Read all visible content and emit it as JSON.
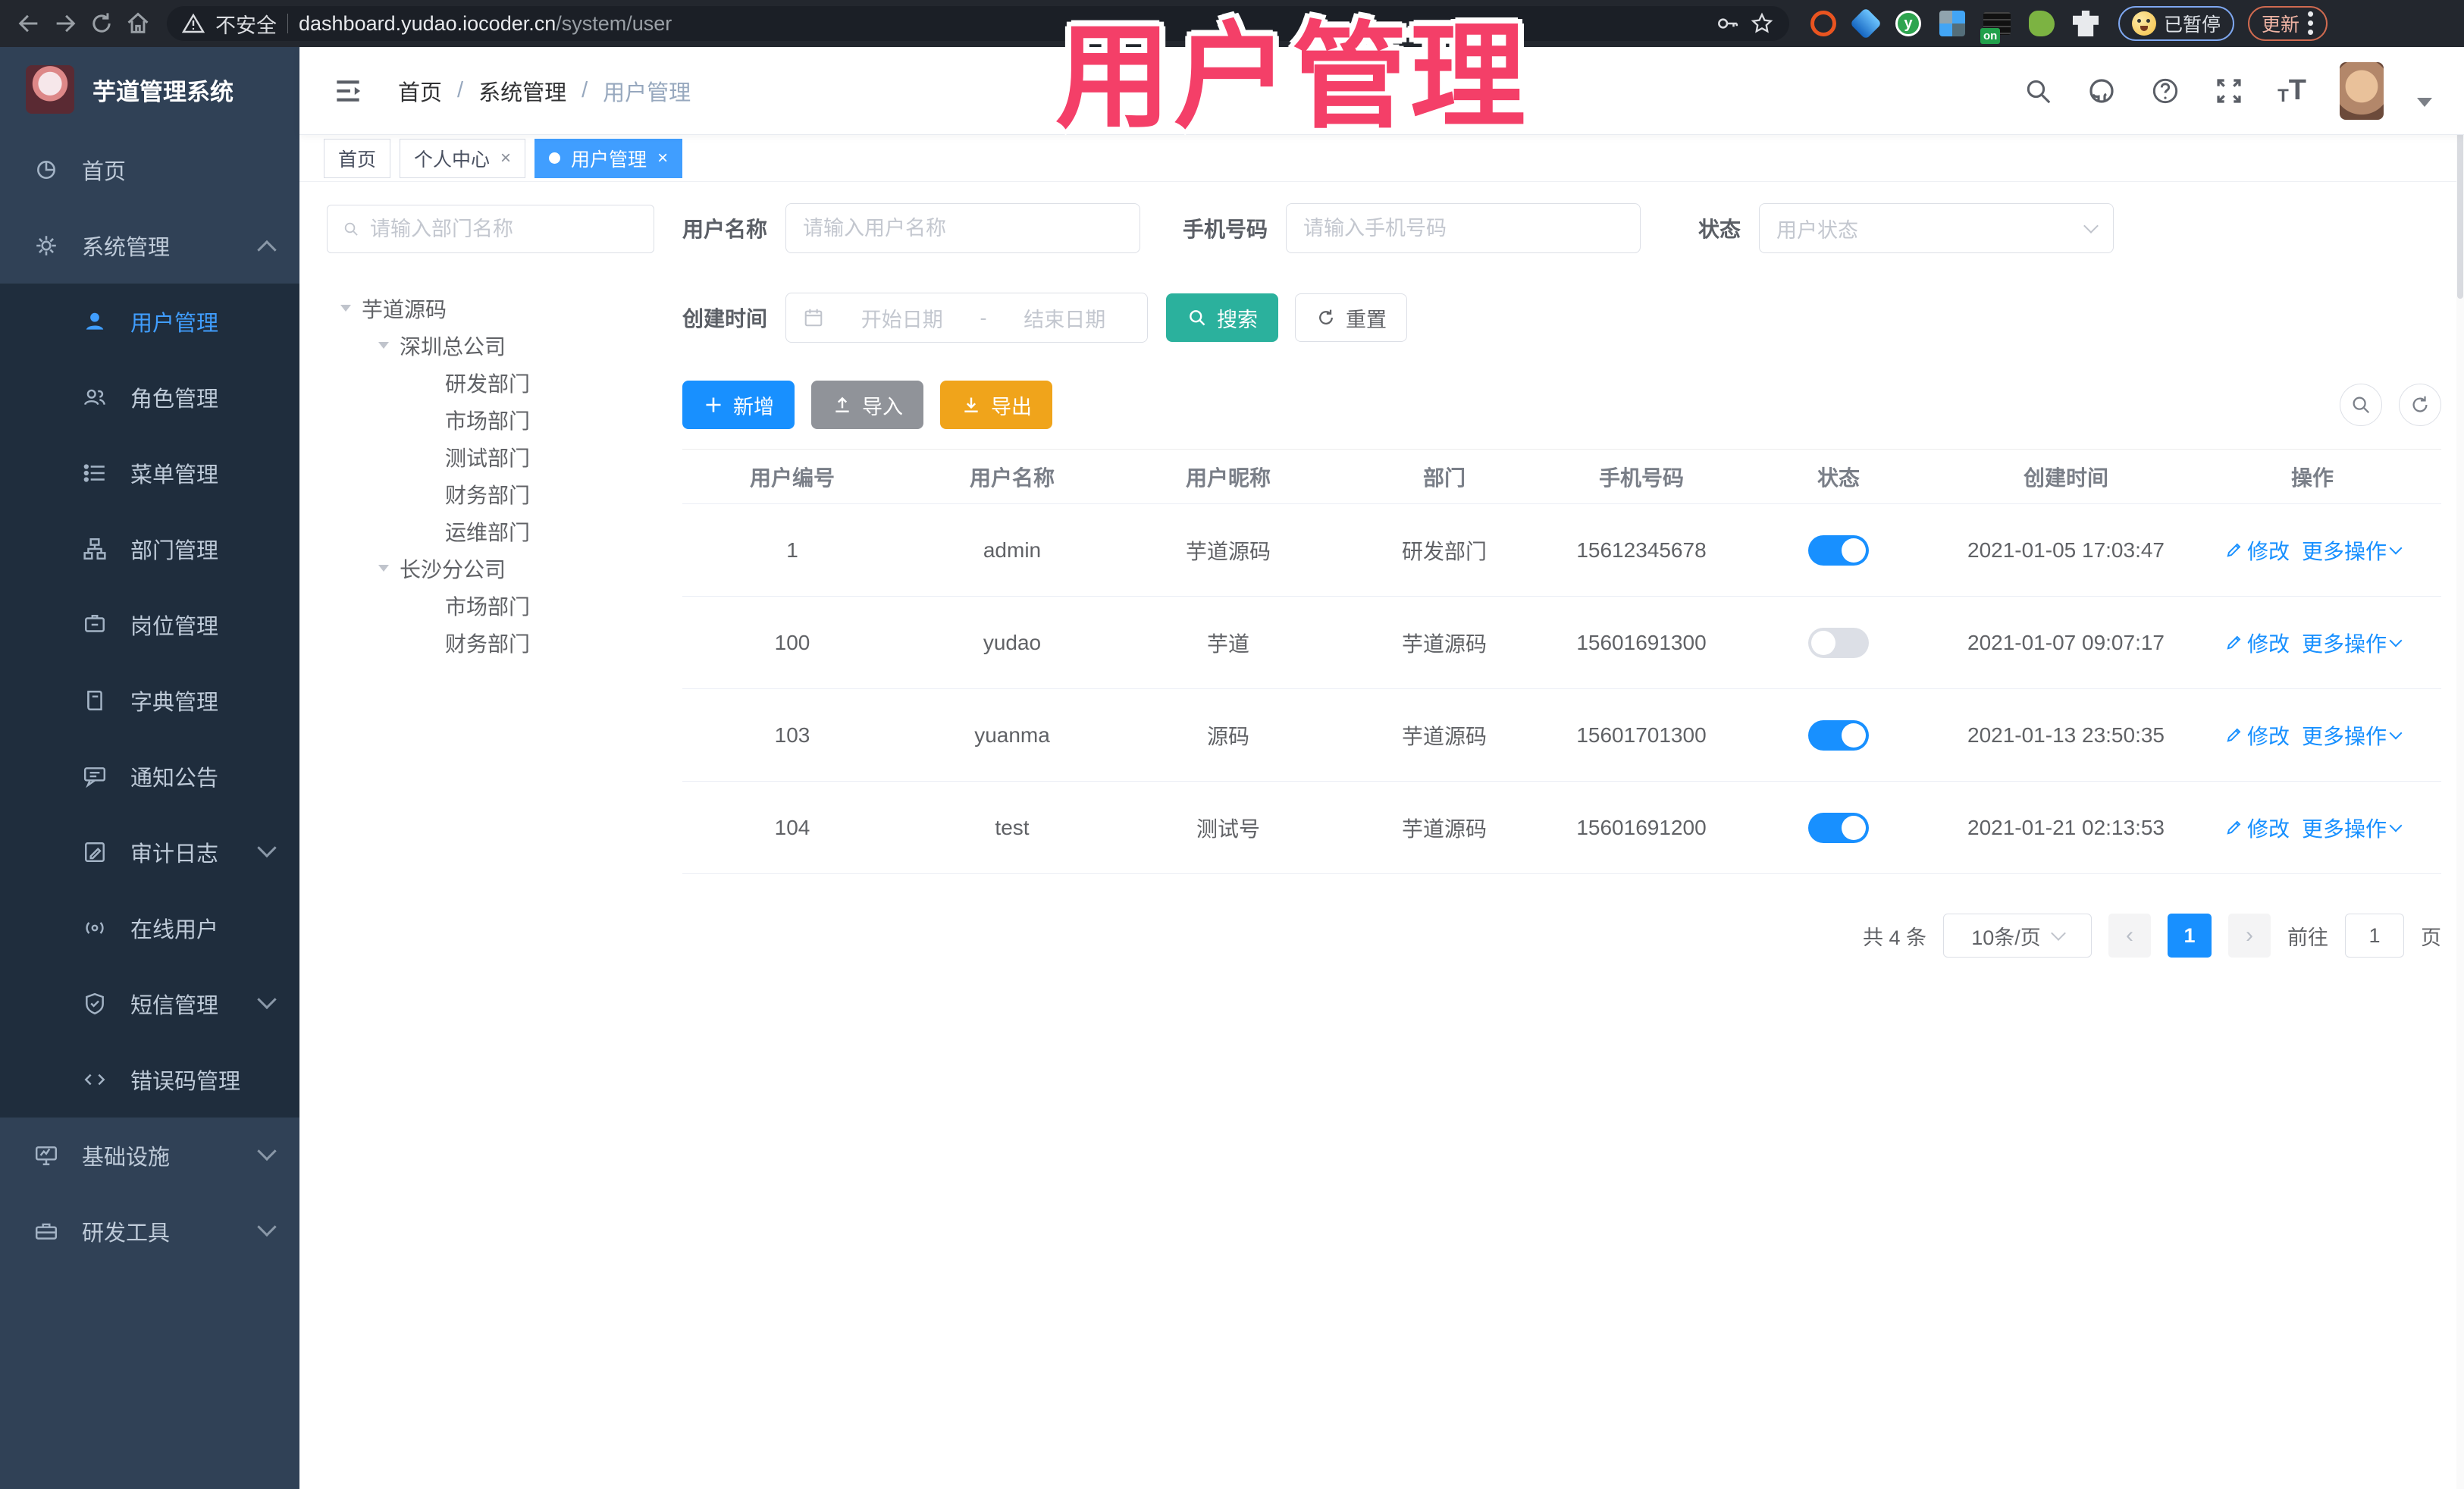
{
  "browser": {
    "security_label": "不安全",
    "url_host": "dashboard.yudao.iocoder.cn",
    "url_path": "/system/user",
    "paused_badge": "已暂停",
    "update_label": "更新",
    "ext_on_badge": "on"
  },
  "overlay": {
    "title": "用户管理",
    "color": "#f43f68"
  },
  "sidebar": {
    "logo_title": "芋道管理系统",
    "items": [
      {
        "label": "首页"
      },
      {
        "label": "系统管理"
      },
      {
        "label": "用户管理"
      },
      {
        "label": "角色管理"
      },
      {
        "label": "菜单管理"
      },
      {
        "label": "部门管理"
      },
      {
        "label": "岗位管理"
      },
      {
        "label": "字典管理"
      },
      {
        "label": "通知公告"
      },
      {
        "label": "审计日志"
      },
      {
        "label": "在线用户"
      },
      {
        "label": "短信管理"
      },
      {
        "label": "错误码管理"
      },
      {
        "label": "基础设施"
      },
      {
        "label": "研发工具"
      }
    ]
  },
  "header": {
    "breadcrumb": [
      "首页",
      "系统管理",
      "用户管理"
    ]
  },
  "tabs": {
    "close_glyph": "×",
    "items": [
      {
        "label": "首页"
      },
      {
        "label": "个人中心"
      },
      {
        "label": "用户管理"
      }
    ]
  },
  "dept_panel": {
    "search_placeholder": "请输入部门名称",
    "tree": [
      {
        "label": "芋道源码"
      },
      {
        "label": "深圳总公司"
      },
      {
        "label": "研发部门"
      },
      {
        "label": "市场部门"
      },
      {
        "label": "测试部门"
      },
      {
        "label": "财务部门"
      },
      {
        "label": "运维部门"
      },
      {
        "label": "长沙分公司"
      },
      {
        "label": "市场部门"
      },
      {
        "label": "财务部门"
      }
    ]
  },
  "filter": {
    "username_label": "用户名称",
    "username_placeholder": "请输入用户名称",
    "mobile_label": "手机号码",
    "mobile_placeholder": "请输入手机号码",
    "status_label": "状态",
    "status_placeholder": "用户状态",
    "create_time_label": "创建时间",
    "date_start_placeholder": "开始日期",
    "date_separator": "-",
    "date_end_placeholder": "结束日期",
    "search_button": "搜索",
    "reset_button": "重置"
  },
  "toolbar": {
    "add_button": "新增",
    "import_button": "导入",
    "export_button": "导出"
  },
  "table": {
    "columns": [
      "用户编号",
      "用户名称",
      "用户昵称",
      "部门",
      "手机号码",
      "状态",
      "创建时间",
      "操作"
    ],
    "edit_label": "修改",
    "more_label": "更多操作",
    "rows": [
      {
        "id": "1",
        "username": "admin",
        "nickname": "芋道源码",
        "dept": "研发部门",
        "mobile": "15612345678",
        "status": "on",
        "created": "2021-01-05 17:03:47"
      },
      {
        "id": "100",
        "username": "yudao",
        "nickname": "芋道",
        "dept": "芋道源码",
        "mobile": "15601691300",
        "status": "off",
        "created": "2021-01-07 09:07:17"
      },
      {
        "id": "103",
        "username": "yuanma",
        "nickname": "源码",
        "dept": "芋道源码",
        "mobile": "15601701300",
        "status": "on",
        "created": "2021-01-13 23:50:35"
      },
      {
        "id": "104",
        "username": "test",
        "nickname": "测试号",
        "dept": "芋道源码",
        "mobile": "15601691200",
        "status": "on",
        "created": "2021-01-21 02:13:53"
      }
    ]
  },
  "pagination": {
    "total_text": "共 4 条",
    "page_size": "10条/页",
    "prev_glyph": "‹",
    "next_glyph": "›",
    "current_page": "1",
    "goto_label": "前往",
    "goto_value": "1",
    "page_unit": "页"
  },
  "colors": {
    "primary": "#1890ff",
    "active_blue": "#409eff",
    "teal": "#2bb19d",
    "warning": "#f0a41b",
    "info_grey": "#909399",
    "sidebar_bg": "#304156",
    "submenu_bg": "#1f2d3d"
  }
}
